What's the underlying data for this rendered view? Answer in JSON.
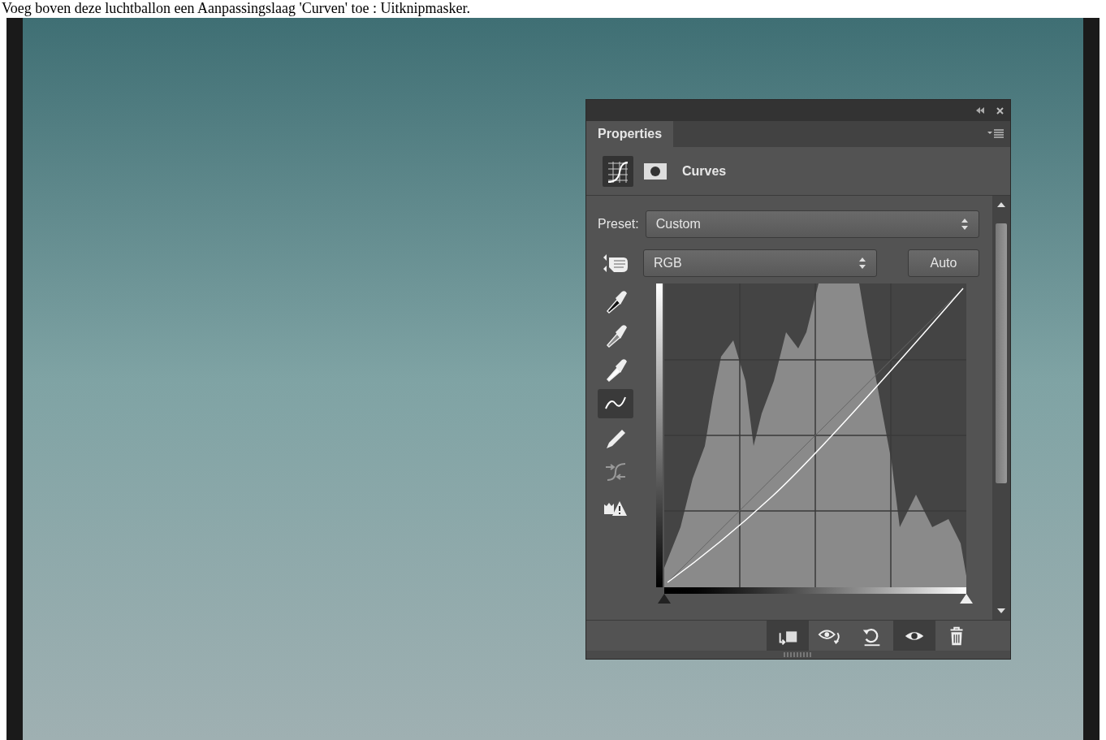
{
  "caption": "Voeg boven deze luchtballon een Aanpassingslaag 'Curven' toe : Uitknipmasker.",
  "panel": {
    "tab": {
      "label": "Properties",
      "selected": true
    },
    "modes": [
      {
        "kind": "curves",
        "selected": true
      },
      {
        "kind": "mask",
        "selected": false
      }
    ],
    "title": "Curves",
    "preset": {
      "label": "Preset:",
      "value": "Custom"
    },
    "channel": {
      "value": "RGB"
    },
    "auto_button": "Auto",
    "input_sliders": [
      {
        "kind": "shadow",
        "level": 0
      },
      {
        "kind": "highlight",
        "level": 1
      }
    ],
    "tools": [
      {
        "kind": "eyedropper-black",
        "selected": false
      },
      {
        "kind": "eyedropper-gray",
        "selected": false
      },
      {
        "kind": "eyedropper-white",
        "selected": false
      },
      {
        "kind": "curve",
        "selected": true
      },
      {
        "kind": "pencil",
        "selected": false
      },
      {
        "kind": "smooth",
        "selected": false
      },
      {
        "kind": "clip-warning",
        "selected": false
      }
    ],
    "footer_buttons": [
      {
        "kind": "clip",
        "selected": true
      },
      {
        "kind": "view-previous",
        "selected": false
      },
      {
        "kind": "reset",
        "selected": false
      },
      {
        "kind": "visibility",
        "selected": true
      },
      {
        "kind": "delete",
        "selected": false
      }
    ]
  }
}
